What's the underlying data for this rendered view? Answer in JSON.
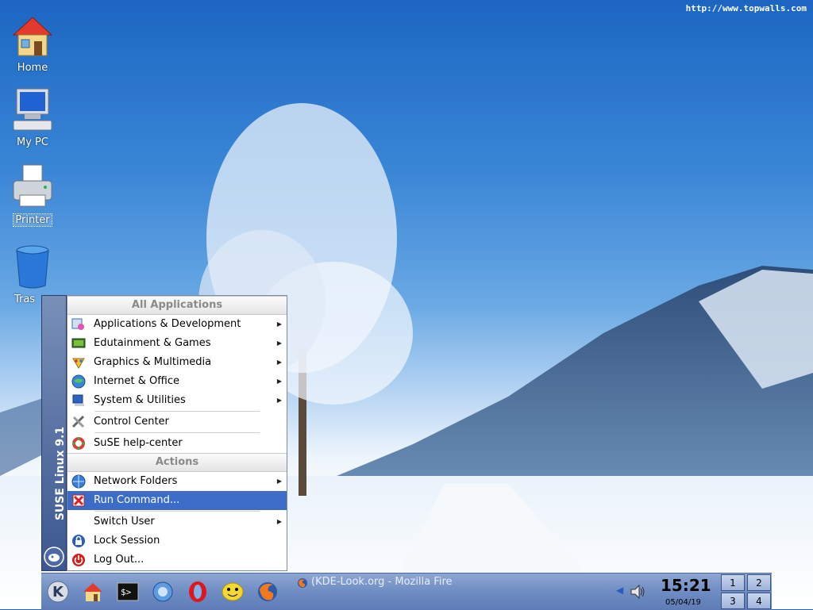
{
  "watermark": "http://www.topwalls.com",
  "desktop": {
    "icons": [
      {
        "label": "Home"
      },
      {
        "label": "My PC"
      },
      {
        "label": "Printer"
      },
      {
        "label": "Tras"
      }
    ]
  },
  "kmenu": {
    "side_text": "SUSE Linux 9.1",
    "section_all": "All Applications",
    "section_actions": "Actions",
    "items": [
      {
        "label": "Applications & Development",
        "icon": "development-icon"
      },
      {
        "label": "Edutainment & Games",
        "icon": "games-icon"
      },
      {
        "label": "Graphics & Multimedia",
        "icon": "graphics-icon"
      },
      {
        "label": "Internet & Office",
        "icon": "internet-icon"
      },
      {
        "label": "System & Utilities",
        "icon": "system-icon"
      },
      {
        "label": "Control Center",
        "icon": "control-center-icon"
      },
      {
        "label": "SuSE help-center",
        "icon": "help-icon"
      }
    ],
    "actions": [
      {
        "label": "Network Folders",
        "icon": "network-folders-icon"
      },
      {
        "label": "Run Command...",
        "icon": "run-command-icon"
      },
      {
        "label": "Switch User",
        "icon": ""
      },
      {
        "label": "Lock Session",
        "icon": "lock-icon"
      },
      {
        "label": "Log Out...",
        "icon": "logout-icon"
      }
    ],
    "highlight_color": "#3b6cc8"
  },
  "taskbar": {
    "task_entry": "(KDE-Look.org - Mozilla Fire",
    "clock_time": "15:21",
    "clock_date": "05/04/19",
    "desktops": [
      "1",
      "2",
      "3",
      "4"
    ]
  }
}
